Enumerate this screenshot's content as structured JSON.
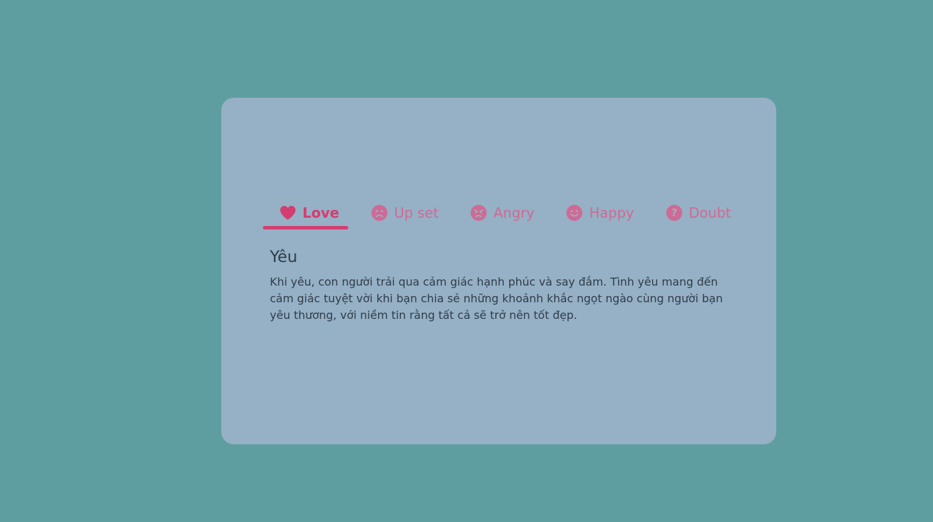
{
  "colors": {
    "background": "#5f9ea0",
    "card": "#96b0c5",
    "active_tab": "#d33d70",
    "inactive_tab": "#cf6a95",
    "text": "#2f3d4a"
  },
  "tabs": [
    {
      "label": "Love",
      "icon": "heart-icon",
      "active": true
    },
    {
      "label": "Up set",
      "icon": "sad-face-icon",
      "active": false
    },
    {
      "label": "Angry",
      "icon": "angry-face-icon",
      "active": false
    },
    {
      "label": "Happy",
      "icon": "smile-face-icon",
      "active": false
    },
    {
      "label": "Doubt",
      "icon": "question-icon",
      "active": false
    }
  ],
  "content": {
    "title": "Yêu",
    "body": "Khi yêu, con người trải qua cảm giác hạnh phúc và say đắm. Tình yêu mang đến cảm giác tuyệt vời khi bạn chia sẻ những khoảnh khắc ngọt ngào cùng người bạn yêu thương, với niềm tin rằng tất cả sẽ trở nên tốt đẹp."
  }
}
